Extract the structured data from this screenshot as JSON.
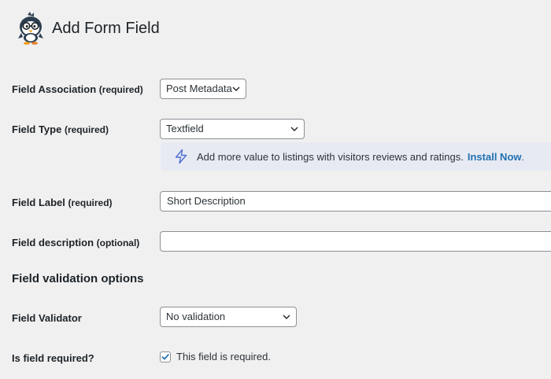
{
  "header": {
    "title": "Add Form Field",
    "logo_icon": "penguin-logo-icon"
  },
  "colors": {
    "background": "#f0f0f1",
    "link": "#2271b1",
    "notice_background": "#e8eaf3",
    "bolt_icon": "#4f6fd1"
  },
  "fields": {
    "association": {
      "label": "Field Association",
      "qualifier": "(required)",
      "value": "Post Metadata"
    },
    "type": {
      "label": "Field Type",
      "qualifier": "(required)",
      "value": "Textfield"
    },
    "notice": {
      "icon": "lightning-bolt-icon",
      "text": "Add more value to listings with visitors reviews and ratings.",
      "link": "Install Now",
      "suffix": "."
    },
    "field_label": {
      "label": "Field Label",
      "qualifier": "(required)",
      "value": "Short Description"
    },
    "description": {
      "label": "Field description",
      "qualifier": "(optional)",
      "value": ""
    }
  },
  "validation": {
    "section_title": "Field validation options",
    "validator": {
      "label": "Field Validator",
      "value": "No validation"
    },
    "required": {
      "label": "Is field required?",
      "checkbox_label": "This field is required.",
      "checked": true
    }
  }
}
